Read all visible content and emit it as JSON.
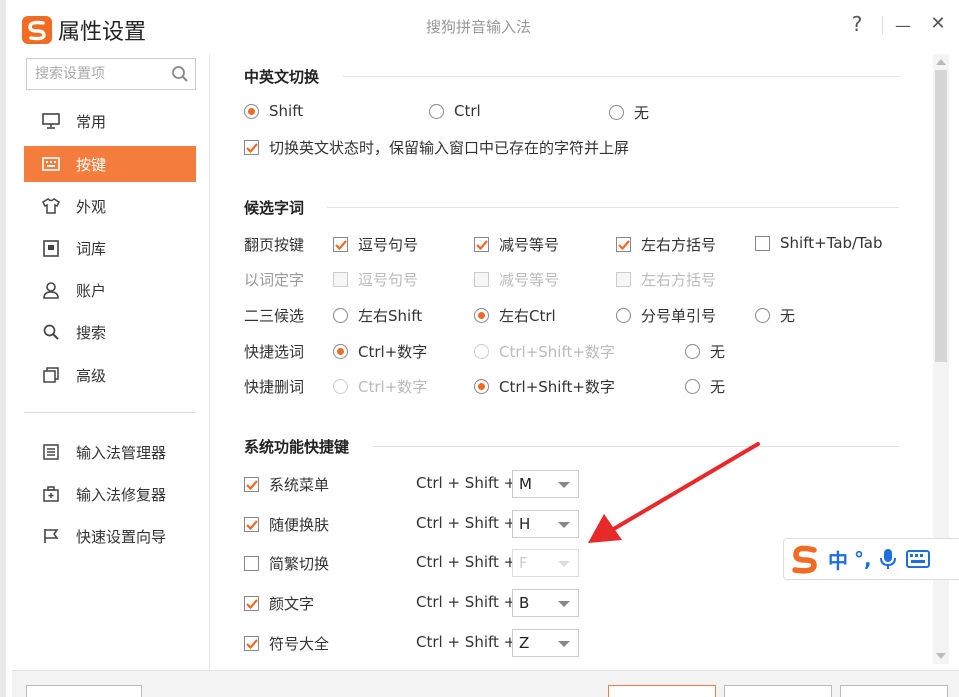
{
  "window": {
    "app_title": "属性设置",
    "center_title": "搜狗拼音输入法",
    "help_label": "?",
    "minimize_label": "—",
    "close_label": "✕"
  },
  "sidebar": {
    "search_placeholder": "搜索设置项",
    "items": [
      {
        "label": "常用",
        "icon": "monitor-icon"
      },
      {
        "label": "按键",
        "icon": "keyboard-icon",
        "active": true
      },
      {
        "label": "外观",
        "icon": "shirt-icon"
      },
      {
        "label": "词库",
        "icon": "book-icon"
      },
      {
        "label": "账户",
        "icon": "user-icon"
      },
      {
        "label": "搜索",
        "icon": "search-icon"
      },
      {
        "label": "高级",
        "icon": "layers-icon"
      }
    ],
    "tools": [
      {
        "label": "输入法管理器",
        "icon": "list-icon"
      },
      {
        "label": "输入法修复器",
        "icon": "toolbox-icon"
      },
      {
        "label": "快速设置向导",
        "icon": "flag-icon"
      }
    ]
  },
  "switch_section": {
    "title": "中英文切换",
    "options": [
      "Shift",
      "Ctrl",
      "无"
    ],
    "selected": "Shift",
    "keep_chars_label": "切换英文状态时，保留输入窗口中已存在的字符并上屏",
    "keep_chars_checked": true
  },
  "candidate_section": {
    "title": "候选字词",
    "rows": [
      {
        "label": "翻页按键",
        "options": [
          "逗号句号",
          "减号等号",
          "左右方括号",
          "Shift+Tab/Tab"
        ]
      },
      {
        "label": "以词定字",
        "options": [
          "逗号句号",
          "减号等号",
          "左右方括号"
        ]
      },
      {
        "label": "二三候选",
        "options": [
          "左右Shift",
          "左右Ctrl",
          "分号单引号",
          "无"
        ],
        "selected": "左右Ctrl"
      },
      {
        "label": "快捷选词",
        "options": [
          "Ctrl+数字",
          "Ctrl+Shift+数字",
          "无"
        ],
        "selected": "Ctrl+数字"
      },
      {
        "label": "快捷删词",
        "options": [
          "Ctrl+数字",
          "Ctrl+Shift+数字",
          "无"
        ],
        "selected": "Ctrl+Shift+数字"
      }
    ]
  },
  "hotkey_section": {
    "title": "系统功能快捷键",
    "prefix": "Ctrl + Shift +",
    "items": [
      {
        "label": "系统菜单",
        "checked": true,
        "key": "M"
      },
      {
        "label": "随便换肤",
        "checked": true,
        "key": "H"
      },
      {
        "label": "简繁切换",
        "checked": false,
        "key": "F"
      },
      {
        "label": "颜文字",
        "checked": true,
        "key": "B"
      },
      {
        "label": "符号大全",
        "checked": true,
        "key": "Z"
      }
    ]
  },
  "ime_toolbar": {
    "mode_label": "中",
    "punct_label": "°,"
  },
  "colors": {
    "accent": "#f47c3c",
    "radio_dot": "#f06a25",
    "ime_blue": "#1e6fd9",
    "arrow_red": "#e8292a"
  }
}
